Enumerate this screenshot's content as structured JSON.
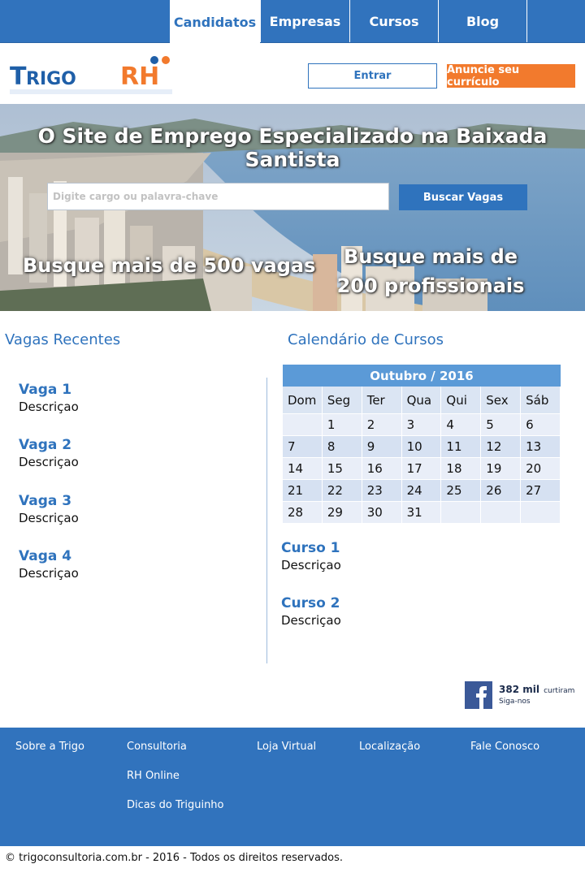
{
  "nav": {
    "tabs": [
      {
        "label": "Candidatos"
      },
      {
        "label": "Empresas"
      },
      {
        "label": "Cursos"
      },
      {
        "label": "Blog"
      }
    ]
  },
  "header": {
    "logo_text": "TrigoRH",
    "login_label": "Entrar",
    "cta_label": "Anuncie seu currículo"
  },
  "hero": {
    "title": "O Site de Emprego Especializado na Baixada Santista",
    "search_placeholder": "Digite cargo ou palavra-chave",
    "search_button": "Buscar Vagas",
    "left_text": "Busque mais de 500 vagas",
    "right_text": "Busque mais de 200 profissionais"
  },
  "jobs": {
    "title": "Vagas Recentes",
    "items": [
      {
        "title": "Vaga 1",
        "desc": "Descriçao"
      },
      {
        "title": "Vaga 2",
        "desc": "Descriçao"
      },
      {
        "title": "Vaga 3",
        "desc": "Descriçao"
      },
      {
        "title": "Vaga 4",
        "desc": "Descriçao"
      }
    ]
  },
  "courses": {
    "title": "Calendário de Cursos",
    "calendar": {
      "month": "Outubro / 2016",
      "weekdays": [
        "Dom",
        "Seg",
        "Ter",
        "Qua",
        "Qui",
        "Sex",
        "Sáb"
      ],
      "weeks": [
        [
          "",
          "1",
          "2",
          "3",
          "4",
          "5",
          "6"
        ],
        [
          "7",
          "8",
          "9",
          "10",
          "11",
          "12",
          "13"
        ],
        [
          "14",
          "15",
          "16",
          "17",
          "18",
          "19",
          "20"
        ],
        [
          "21",
          "22",
          "23",
          "24",
          "25",
          "26",
          "27"
        ],
        [
          "28",
          "29",
          "30",
          "31",
          "",
          "",
          ""
        ]
      ]
    },
    "items": [
      {
        "title": "Curso 1",
        "desc": "Descriçao"
      },
      {
        "title": "Curso 2",
        "desc": "Descriçao"
      }
    ]
  },
  "facebook": {
    "count": "382 mil",
    "liked": "curtiram",
    "follow": "Siga-nos"
  },
  "footer": {
    "links": {
      "sobre": "Sobre a Trigo",
      "consultoria": "Consultoria",
      "rh_online": "RH Online",
      "dicas": "Dicas do Triguinho",
      "loja": "Loja Virtual",
      "localizacao": "Localização",
      "contato": "Fale Conosco"
    },
    "copyright": "© trigoconsultoria.com.br - 2016 - Todos os direitos reservados."
  },
  "colors": {
    "brand_blue": "#3173bd",
    "accent_orange": "#f27a2d",
    "calendar_header": "#5b9ad7"
  }
}
